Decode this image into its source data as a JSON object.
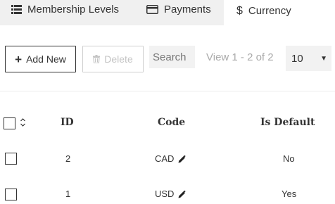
{
  "tabs": [
    {
      "label": "Membership Levels",
      "icon": "list-icon"
    },
    {
      "label": "Payments",
      "icon": "credit-card-icon"
    },
    {
      "label": "Currency",
      "icon": "dollar-icon",
      "active": true
    }
  ],
  "toolbar": {
    "add_label": "Add New",
    "delete_label": "Delete",
    "search_placeholder": "Search",
    "view_info": "View 1 - 2 of 2",
    "page_size": "10"
  },
  "table": {
    "headers": {
      "id": "ID",
      "code": "Code",
      "is_default": "Is Default"
    },
    "rows": [
      {
        "id": "2",
        "code": "CAD",
        "is_default": "No"
      },
      {
        "id": "1",
        "code": "USD",
        "is_default": "Yes"
      }
    ]
  },
  "colors": {
    "tab_bg": "#f0f0f0",
    "disabled": "#c4c4c4",
    "muted_text": "#aaaaaa"
  }
}
